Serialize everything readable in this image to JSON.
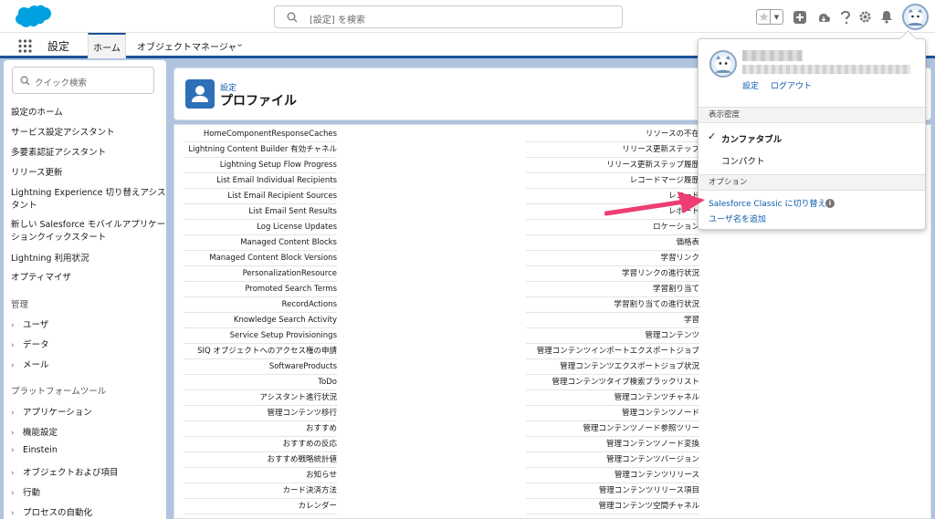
{
  "header": {
    "search_placeholder": "[設定] を検索",
    "brand_color": "#00a1e0"
  },
  "nav": {
    "app_name": "設定",
    "tabs": [
      {
        "label": "ホーム"
      },
      {
        "label": "オブジェクトマネージャ"
      }
    ]
  },
  "sidebar": {
    "search_placeholder": "クイック検索",
    "items": [
      "設定のホーム",
      "サービス設定アシスタント",
      "多要素認証アシスタント",
      "リリース更新",
      "Lightning Experience 切り替えアシスタント",
      "新しい Salesforce モバイルアプリケーションクイックスタート",
      "Lightning 利用状況",
      "オプティマイザ"
    ],
    "admin_heading": "管理",
    "admin_items": [
      "ユーザ",
      "データ",
      "メール"
    ],
    "platform_heading": "プラットフォームツール",
    "platform_items": [
      "アプリケーション",
      "機能設定",
      "Einstein",
      "オブジェクトおよび項目",
      "行動",
      "プロセスの自動化"
    ]
  },
  "page": {
    "breadcrumb": "設定",
    "title": "プロファイル"
  },
  "list": {
    "left": [
      "HomeComponentResponseCaches",
      "Lightning Content Builder 有効チャネル",
      "Lightning Setup Flow Progress",
      "List Email Individual Recipients",
      "List Email Recipient Sources",
      "List Email Sent Results",
      "Log License Updates",
      "Managed Content Blocks",
      "Managed Content Block Versions",
      "PersonalizationResource",
      "Promoted Search Terms",
      "RecordActions",
      "Knowledge Search Activity",
      "Service Setup Provisionings",
      "SIQ オブジェクトへのアクセス権の申請",
      "SoftwareProducts",
      "ToDo",
      "アシスタント進行状況",
      "管理コンテンツ移行",
      "おすすめ",
      "おすすめの反応",
      "おすすめ戦略統計値",
      "お知らせ",
      "カード決済方法",
      "カレンダー"
    ],
    "right": [
      "リソースの不在",
      "リリース更新ステップ",
      "リリース更新ステップ履歴",
      "レコードマージ履歴",
      "レコード",
      "レポート",
      "ロケーション",
      "価格表",
      "学習リンク",
      "学習リンクの進行状況",
      "学習割り当て",
      "学習割り当ての進行状況",
      "学習",
      "管理コンテンツ",
      "管理コンテンツインポートエクスポートジョブ",
      "管理コンテンツエクスポートジョブ状況",
      "管理コンテンツタイプ検索ブラックリスト",
      "管理コンテンツチャネル",
      "管理コンテンツノード",
      "管理コンテンツノード参照ツリー",
      "管理コンテンツノード変換",
      "管理コンテンツバージョン",
      "管理コンテンツリリース",
      "管理コンテンツリリース項目",
      "管理コンテンツ空間チャネル"
    ]
  },
  "dropdown": {
    "settings_link": "設定",
    "logout_link": "ログアウト",
    "density_heading": "表示密度",
    "density_comfy": "カンファタブル",
    "density_compact": "コンパクト",
    "options_heading": "オプション",
    "switch_classic": "Salesforce Classic に切り替え",
    "add_username": "ユーザ名を追加",
    "info_glyph": "i"
  },
  "colors": {
    "arrow": "#ee3d72",
    "link": "#0b5cab",
    "nav_accent": "#1b5297"
  }
}
